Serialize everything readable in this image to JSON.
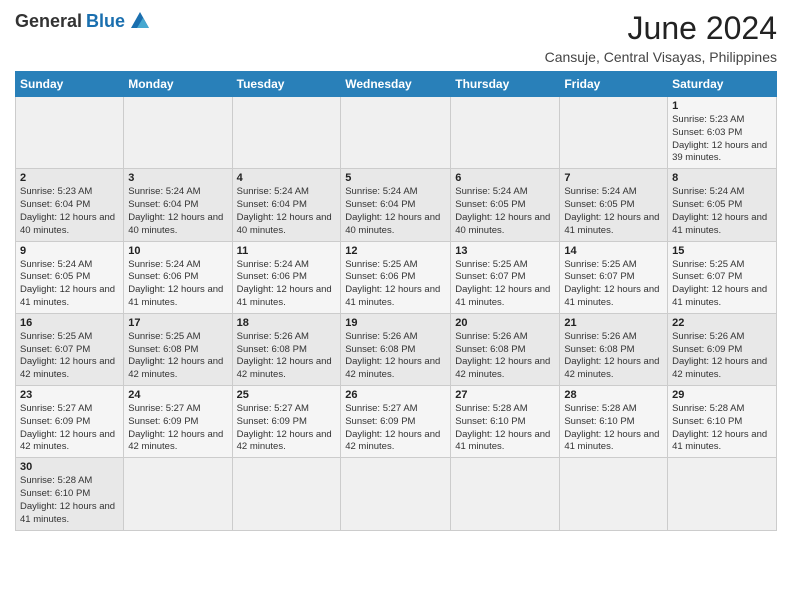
{
  "header": {
    "logo_general": "General",
    "logo_blue": "Blue",
    "month_title": "June 2024",
    "location": "Cansuje, Central Visayas, Philippines"
  },
  "days_of_week": [
    "Sunday",
    "Monday",
    "Tuesday",
    "Wednesday",
    "Thursday",
    "Friday",
    "Saturday"
  ],
  "weeks": [
    [
      {
        "day": "",
        "info": ""
      },
      {
        "day": "",
        "info": ""
      },
      {
        "day": "",
        "info": ""
      },
      {
        "day": "",
        "info": ""
      },
      {
        "day": "",
        "info": ""
      },
      {
        "day": "",
        "info": ""
      },
      {
        "day": "1",
        "info": "Sunrise: 5:23 AM\nSunset: 6:03 PM\nDaylight: 12 hours and 39 minutes."
      }
    ],
    [
      {
        "day": "2",
        "info": "Sunrise: 5:23 AM\nSunset: 6:04 PM\nDaylight: 12 hours and 40 minutes."
      },
      {
        "day": "3",
        "info": "Sunrise: 5:24 AM\nSunset: 6:04 PM\nDaylight: 12 hours and 40 minutes."
      },
      {
        "day": "4",
        "info": "Sunrise: 5:24 AM\nSunset: 6:04 PM\nDaylight: 12 hours and 40 minutes."
      },
      {
        "day": "5",
        "info": "Sunrise: 5:24 AM\nSunset: 6:04 PM\nDaylight: 12 hours and 40 minutes."
      },
      {
        "day": "6",
        "info": "Sunrise: 5:24 AM\nSunset: 6:05 PM\nDaylight: 12 hours and 40 minutes."
      },
      {
        "day": "7",
        "info": "Sunrise: 5:24 AM\nSunset: 6:05 PM\nDaylight: 12 hours and 41 minutes."
      },
      {
        "day": "8",
        "info": "Sunrise: 5:24 AM\nSunset: 6:05 PM\nDaylight: 12 hours and 41 minutes."
      }
    ],
    [
      {
        "day": "9",
        "info": "Sunrise: 5:24 AM\nSunset: 6:05 PM\nDaylight: 12 hours and 41 minutes."
      },
      {
        "day": "10",
        "info": "Sunrise: 5:24 AM\nSunset: 6:06 PM\nDaylight: 12 hours and 41 minutes."
      },
      {
        "day": "11",
        "info": "Sunrise: 5:24 AM\nSunset: 6:06 PM\nDaylight: 12 hours and 41 minutes."
      },
      {
        "day": "12",
        "info": "Sunrise: 5:25 AM\nSunset: 6:06 PM\nDaylight: 12 hours and 41 minutes."
      },
      {
        "day": "13",
        "info": "Sunrise: 5:25 AM\nSunset: 6:07 PM\nDaylight: 12 hours and 41 minutes."
      },
      {
        "day": "14",
        "info": "Sunrise: 5:25 AM\nSunset: 6:07 PM\nDaylight: 12 hours and 41 minutes."
      },
      {
        "day": "15",
        "info": "Sunrise: 5:25 AM\nSunset: 6:07 PM\nDaylight: 12 hours and 41 minutes."
      }
    ],
    [
      {
        "day": "16",
        "info": "Sunrise: 5:25 AM\nSunset: 6:07 PM\nDaylight: 12 hours and 42 minutes."
      },
      {
        "day": "17",
        "info": "Sunrise: 5:25 AM\nSunset: 6:08 PM\nDaylight: 12 hours and 42 minutes."
      },
      {
        "day": "18",
        "info": "Sunrise: 5:26 AM\nSunset: 6:08 PM\nDaylight: 12 hours and 42 minutes."
      },
      {
        "day": "19",
        "info": "Sunrise: 5:26 AM\nSunset: 6:08 PM\nDaylight: 12 hours and 42 minutes."
      },
      {
        "day": "20",
        "info": "Sunrise: 5:26 AM\nSunset: 6:08 PM\nDaylight: 12 hours and 42 minutes."
      },
      {
        "day": "21",
        "info": "Sunrise: 5:26 AM\nSunset: 6:08 PM\nDaylight: 12 hours and 42 minutes."
      },
      {
        "day": "22",
        "info": "Sunrise: 5:26 AM\nSunset: 6:09 PM\nDaylight: 12 hours and 42 minutes."
      }
    ],
    [
      {
        "day": "23",
        "info": "Sunrise: 5:27 AM\nSunset: 6:09 PM\nDaylight: 12 hours and 42 minutes."
      },
      {
        "day": "24",
        "info": "Sunrise: 5:27 AM\nSunset: 6:09 PM\nDaylight: 12 hours and 42 minutes."
      },
      {
        "day": "25",
        "info": "Sunrise: 5:27 AM\nSunset: 6:09 PM\nDaylight: 12 hours and 42 minutes."
      },
      {
        "day": "26",
        "info": "Sunrise: 5:27 AM\nSunset: 6:09 PM\nDaylight: 12 hours and 42 minutes."
      },
      {
        "day": "27",
        "info": "Sunrise: 5:28 AM\nSunset: 6:10 PM\nDaylight: 12 hours and 41 minutes."
      },
      {
        "day": "28",
        "info": "Sunrise: 5:28 AM\nSunset: 6:10 PM\nDaylight: 12 hours and 41 minutes."
      },
      {
        "day": "29",
        "info": "Sunrise: 5:28 AM\nSunset: 6:10 PM\nDaylight: 12 hours and 41 minutes."
      }
    ],
    [
      {
        "day": "30",
        "info": "Sunrise: 5:28 AM\nSunset: 6:10 PM\nDaylight: 12 hours and 41 minutes."
      },
      {
        "day": "",
        "info": ""
      },
      {
        "day": "",
        "info": ""
      },
      {
        "day": "",
        "info": ""
      },
      {
        "day": "",
        "info": ""
      },
      {
        "day": "",
        "info": ""
      },
      {
        "day": "",
        "info": ""
      }
    ]
  ]
}
